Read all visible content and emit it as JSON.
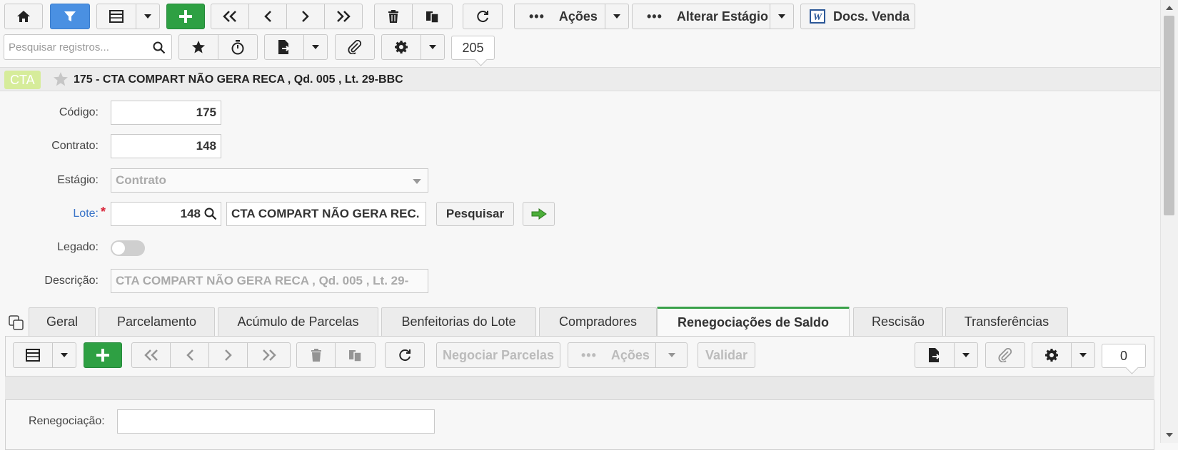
{
  "toolbar": {
    "actions_label": "Ações",
    "alter_stage_label": "Alterar Estágio",
    "docs_label": "Docs. Venda",
    "search_placeholder": "Pesquisar registros...",
    "record_count": "205"
  },
  "record": {
    "badge": "CTA",
    "title": "175 - CTA COMPART NÃO GERA RECA , Qd. 005 , Lt. 29-BBC"
  },
  "form": {
    "codigo_label": "Código:",
    "codigo_value": "175",
    "contrato_label": "Contrato:",
    "contrato_value": "148",
    "estagio_label": "Estágio:",
    "estagio_value": "Contrato",
    "lote_label": "Lote:",
    "lote_required": "*",
    "lote_value": "148",
    "lote_desc": "CTA COMPART NÃO GERA REC.",
    "pesquisar_label": "Pesquisar",
    "legado_label": "Legado:",
    "descricao_label": "Descrição:",
    "descricao_value": "CTA COMPART NÃO GERA RECA ,  Qd. 005 ,  Lt. 29-"
  },
  "tabs": [
    {
      "label": "Geral"
    },
    {
      "label": "Parcelamento"
    },
    {
      "label": "Acúmulo de Parcelas"
    },
    {
      "label": "Benfeitorias do Lote"
    },
    {
      "label": "Compradores"
    },
    {
      "label": "Renegociações de Saldo"
    },
    {
      "label": "Rescisão"
    },
    {
      "label": "Transferências"
    }
  ],
  "active_tab_index": 5,
  "subtoolbar": {
    "negociar_label": "Negociar Parcelas",
    "actions_label": "Ações",
    "validar_label": "Validar",
    "record_count": "0"
  },
  "subform": {
    "renegociacao_label": "Renegociação:",
    "renegociacao_value": ""
  },
  "colors": {
    "accent_blue": "#4a90e2",
    "add_green": "#2ea043",
    "active_tab_border": "#3aa14a",
    "badge_bg": "#d6ec9a",
    "link_blue": "#3a74c8",
    "required_red": "#d9263b"
  }
}
